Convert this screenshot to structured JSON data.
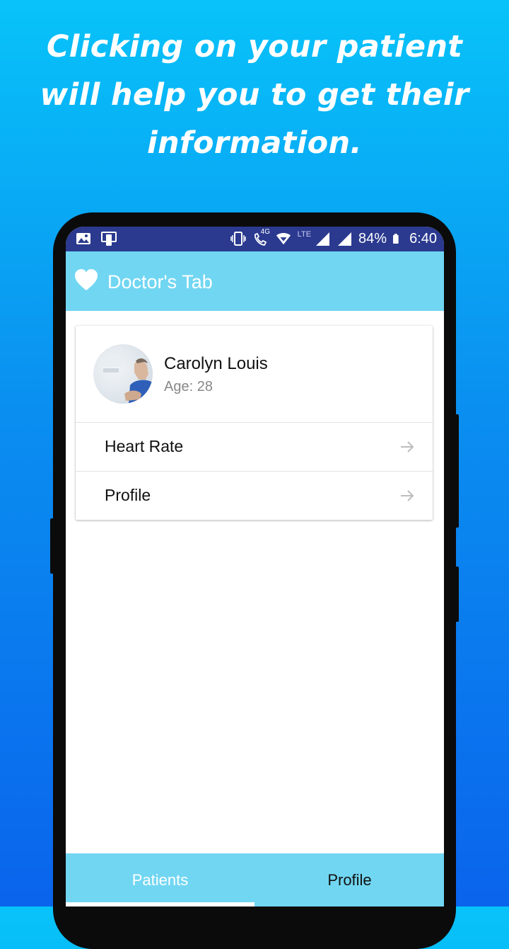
{
  "promo": {
    "headline_line1": "Clicking on your patient",
    "headline_line2": "will help you to get their",
    "headline_line3": "information."
  },
  "status_bar": {
    "network": "LTE",
    "data_type": "4G",
    "battery": "84%",
    "time": "6:40"
  },
  "app_bar": {
    "title": "Doctor's Tab"
  },
  "patient": {
    "name": "Carolyn Louis",
    "age": "Age: 28",
    "menu": [
      {
        "label": "Heart Rate"
      },
      {
        "label": "Profile"
      }
    ]
  },
  "bottom_nav": {
    "tabs": [
      {
        "label": "Patients",
        "selected": true
      },
      {
        "label": "Profile",
        "selected": false
      }
    ]
  },
  "colors": {
    "background_top": "#08c3f9",
    "background_bottom": "#0a64ec",
    "status_bar": "#2b3a8f",
    "accent": "#71d6f2"
  }
}
